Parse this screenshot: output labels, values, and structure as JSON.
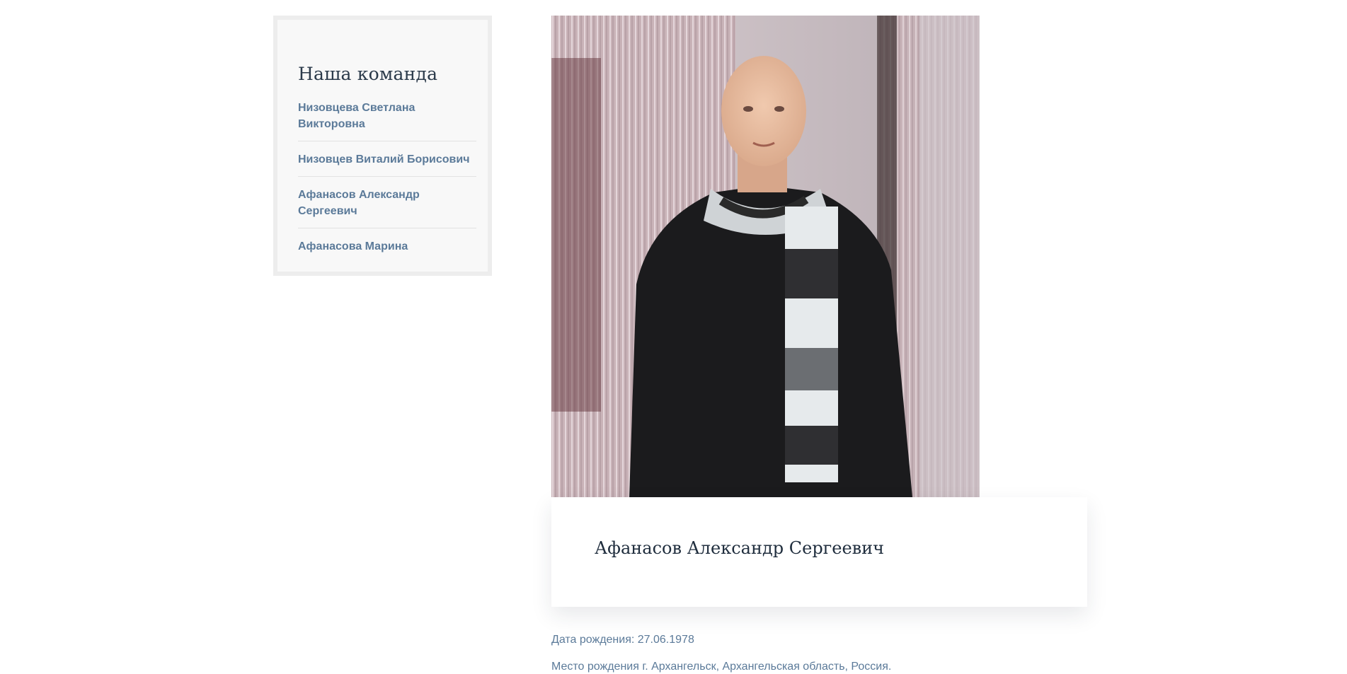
{
  "sidebar": {
    "title": "Наша команда",
    "items": [
      {
        "label": "Низовцева Светлана Викторовна"
      },
      {
        "label": "Низовцев Виталий Борисович"
      },
      {
        "label": "Афанасов Александр Сергеевич"
      },
      {
        "label": "Афанасова Марина"
      }
    ]
  },
  "profile": {
    "name": "Афанасов Александр Сергеевич",
    "birthdate": "Дата рождения: 27.06.1978",
    "birthplace": "Место рождения г. Архангельск, Архангельская область, Россия."
  },
  "colors": {
    "link": "#5b7a99",
    "heading": "#1f2d3d",
    "sidebar_bg": "#f8f8f8",
    "sidebar_border": "#ededed"
  }
}
